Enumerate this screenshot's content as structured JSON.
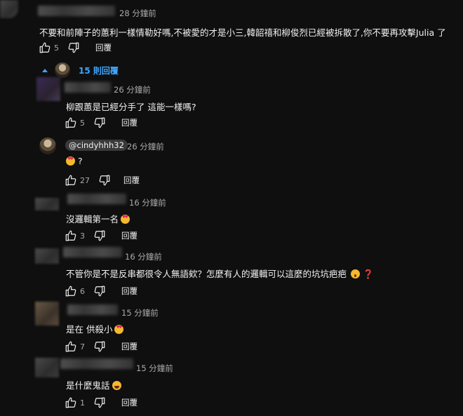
{
  "top_comment": {
    "time": "28 分鐘前",
    "text": "不要和前陣子的蕙利一樣情勒好嗎,不被愛的才是小三,韓韶禧和柳俊烈已經被拆散了,你不要再攻擊Julia 了",
    "likes": "5",
    "reply_label": "回覆"
  },
  "replies_toggle": {
    "label": "15 則回覆",
    "icon": "chevron-up-icon"
  },
  "replies": [
    {
      "time": "26 分鐘前",
      "text": "柳跟蕙是已經分手了 這能一樣嗎?",
      "likes": "5",
      "reply_label": "回覆"
    },
    {
      "mention": "@cindyhhh32",
      "time": "26 分鐘前",
      "text": "?",
      "emoji": "heart-eyes",
      "likes": "27",
      "reply_label": "回覆"
    },
    {
      "time": "16 分鐘前",
      "text": "沒邏輯第一名",
      "emoji": "heart-eyes",
      "likes": "3",
      "reply_label": "回覆"
    },
    {
      "time": "16 分鐘前",
      "text": "不管你是不是反串都很令人無語欸？怎麼有人的邏輯可以這麼的坑坑疤疤",
      "emoji": "surprised",
      "extra": "❓",
      "likes": "6",
      "reply_label": "回覆"
    },
    {
      "time": "15 分鐘前",
      "text": "是在 供殺小",
      "emoji": "heart-eyes",
      "likes": "7",
      "reply_label": "回覆"
    },
    {
      "time": "15 分鐘前",
      "text": "是什麼鬼話",
      "emoji": "laugh",
      "likes": "1",
      "reply_label": "回覆"
    }
  ],
  "colors": {
    "background": "#0f0f0f",
    "text": "#f1f1f1",
    "secondary": "#aaaaaa",
    "link": "#3ea6ff"
  }
}
